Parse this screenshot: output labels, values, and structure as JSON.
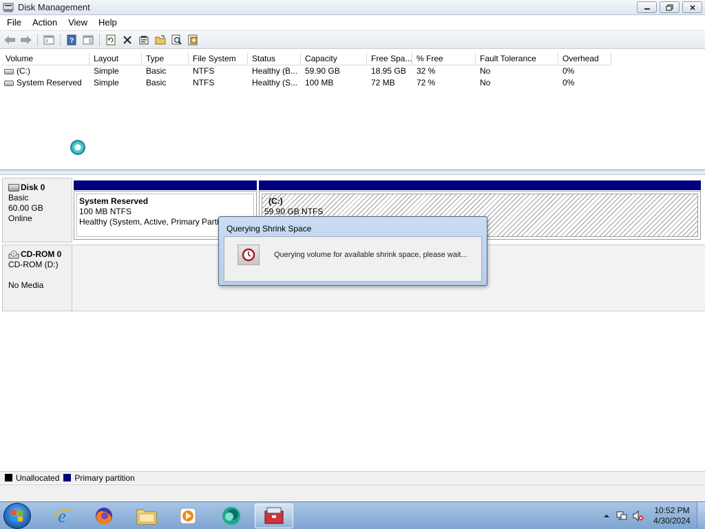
{
  "window": {
    "title": "Disk Management",
    "controls": [
      "minimize",
      "restore",
      "close"
    ]
  },
  "menubar": {
    "items": [
      "File",
      "Action",
      "View",
      "Help"
    ]
  },
  "toolbar": {
    "icons": [
      "back-icon",
      "forward-icon",
      "properties-pane-icon",
      "help-icon",
      "console-pane-icon",
      "refresh-icon",
      "delete-icon",
      "properties-icon",
      "open-icon",
      "search-icon",
      "settings-icon"
    ]
  },
  "volume_list": {
    "columns": [
      "Volume",
      "Layout",
      "Type",
      "File System",
      "Status",
      "Capacity",
      "Free Spa...",
      "% Free",
      "Fault Tolerance",
      "Overhead"
    ],
    "rows": [
      [
        "(C:)",
        "Simple",
        "Basic",
        "NTFS",
        "Healthy (B...",
        "59.90 GB",
        "18.95 GB",
        "32 %",
        "No",
        "0%"
      ],
      [
        "System Reserved",
        "Simple",
        "Basic",
        "NTFS",
        "Healthy (S...",
        "100 MB",
        "72 MB",
        "72 %",
        "No",
        "0%"
      ]
    ]
  },
  "disks": {
    "disk0": {
      "name": "Disk 0",
      "type": "Basic",
      "size": "60.00 GB",
      "state": "Online",
      "partitions": [
        {
          "name": "System Reserved",
          "size": "100 MB NTFS",
          "status": "Healthy (System, Active, Primary Partiti"
        },
        {
          "name": "(C:)",
          "size": "59.90 GB NTFS"
        }
      ]
    },
    "cdrom0": {
      "name": "CD-ROM 0",
      "drive": "CD-ROM (D:)",
      "media": "No Media"
    }
  },
  "legend": {
    "items": [
      {
        "label": "Unallocated",
        "color": "#000000"
      },
      {
        "label": "Primary partition",
        "color": "#00007f"
      }
    ]
  },
  "dialog": {
    "title": "Querying Shrink Space",
    "message": "Querying volume for available shrink space, please wait..."
  },
  "taskbar": {
    "apps": [
      "internet-explorer-icon",
      "firefox-icon",
      "file-explorer-icon",
      "media-player-icon",
      "browser-icon",
      "computer-management-icon"
    ],
    "clock": {
      "time": "10:52 PM",
      "date": "4/30/2024"
    }
  }
}
